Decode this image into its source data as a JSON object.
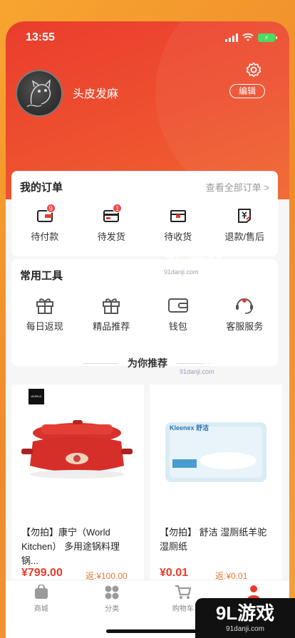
{
  "status": {
    "time": "13:55"
  },
  "profile": {
    "username": "头皮发麻",
    "edit_label": "编辑"
  },
  "orders": {
    "title": "我的订单",
    "view_all": "查看全部订单 >",
    "items": [
      {
        "label": "待付款",
        "badge": "9",
        "icon": "wallet-icon"
      },
      {
        "label": "待发货",
        "badge": "1",
        "icon": "card-icon"
      },
      {
        "label": "待收货",
        "badge": "",
        "icon": "box-icon"
      },
      {
        "label": "退款/售后",
        "badge": "",
        "icon": "refund-icon"
      }
    ]
  },
  "tools": {
    "title": "常用工具",
    "items": [
      {
        "label": "每日返现",
        "icon": "gift-icon"
      },
      {
        "label": "精品推荐",
        "icon": "gift-icon"
      },
      {
        "label": "钱包",
        "icon": "wallet-icon"
      },
      {
        "label": "客服服务",
        "icon": "headset-icon"
      }
    ]
  },
  "recommend": {
    "title": "为你推荐",
    "products": [
      {
        "name": "【勿拍】康宁（World Kitchen） 多用途锅料理锅...",
        "price": "¥799.00",
        "rebate": "返:¥100.00",
        "logo_text": "WORLD KITCHEN"
      },
      {
        "name": "【勿拍】 舒洁 湿厕纸羊驼湿厕纸",
        "price": "¥0.01",
        "rebate": "返:¥0.01",
        "package_text": "Kleenex 舒洁"
      }
    ]
  },
  "tabbar": [
    {
      "label": "商城",
      "icon": "shop-icon"
    },
    {
      "label": "分类",
      "icon": "grid-icon"
    },
    {
      "label": "购物车",
      "icon": "cart-icon"
    },
    {
      "label": "我的",
      "icon": "user-icon"
    }
  ],
  "watermark": {
    "brand": "9L游戏",
    "domain": "91danji.com",
    "corner_domain": "91danji.com"
  },
  "colors": {
    "accent": "#e73c2c",
    "header": "#ee5130",
    "badge": "#f04b4b"
  }
}
